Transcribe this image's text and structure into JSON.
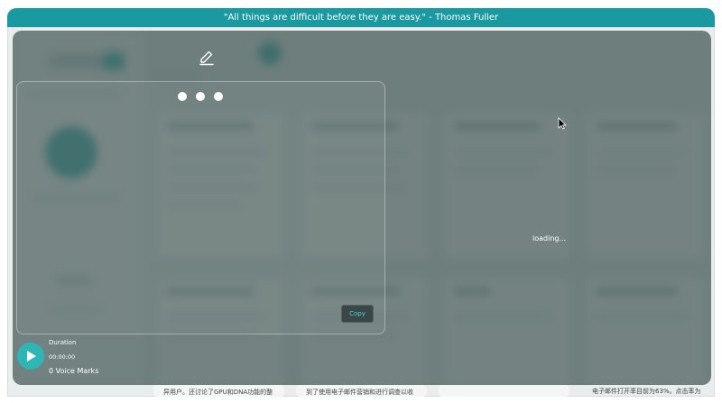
{
  "banner": {
    "quote": "\"All things are difficult before they are easy.\" - Thomas Fuller"
  },
  "recorder": {
    "copy_label": "Copy",
    "duration_label": "Duration",
    "duration_value": "00:00:00",
    "voice_marks": "0 Voice Marks"
  },
  "status": {
    "loading_text": "loading..."
  },
  "background_cards": {
    "snippet_1": "异用户。还讨论了GPU和DNA功能的整",
    "snippet_2": "到了使用电子邮件营销和进行调查以收",
    "snippet_3": "电子邮件打开率目前为63%。点击率为"
  },
  "colors": {
    "accent": "#1a9aa0",
    "play": "#2fb6b4",
    "overlay": "#4f6260"
  },
  "icons": {
    "edit": "pencil-icon",
    "play": "play-icon",
    "cursor": "cursor-icon"
  }
}
